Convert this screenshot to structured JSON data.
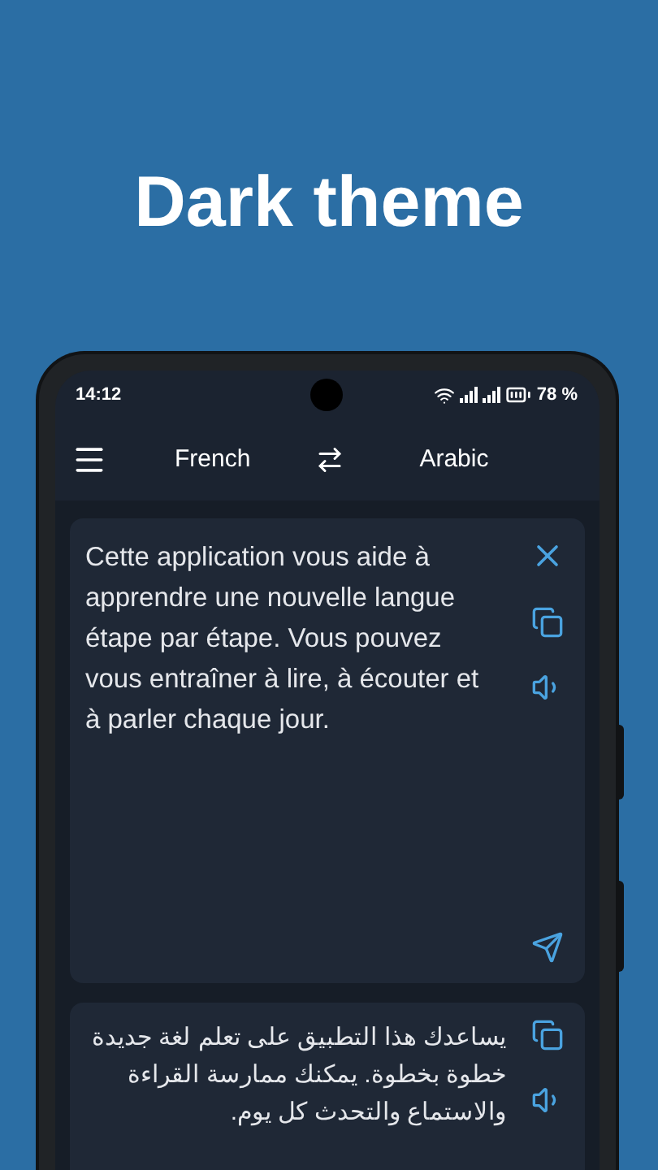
{
  "headline": "Dark theme",
  "status_bar": {
    "time": "14:12",
    "battery": "78 %"
  },
  "top_bar": {
    "source_language": "French",
    "target_language": "Arabic"
  },
  "source_card": {
    "text": "Cette application vous aide à apprendre une nouvelle langue étape par étape. Vous pouvez vous entraîner à lire, à écouter et à parler chaque jour."
  },
  "result_card": {
    "text": "يساعدك هذا التطبيق على تعلم لغة جديدة خطوة بخطوة. يمكنك ممارسة القراءة والاستماع والتحدث كل يوم."
  }
}
